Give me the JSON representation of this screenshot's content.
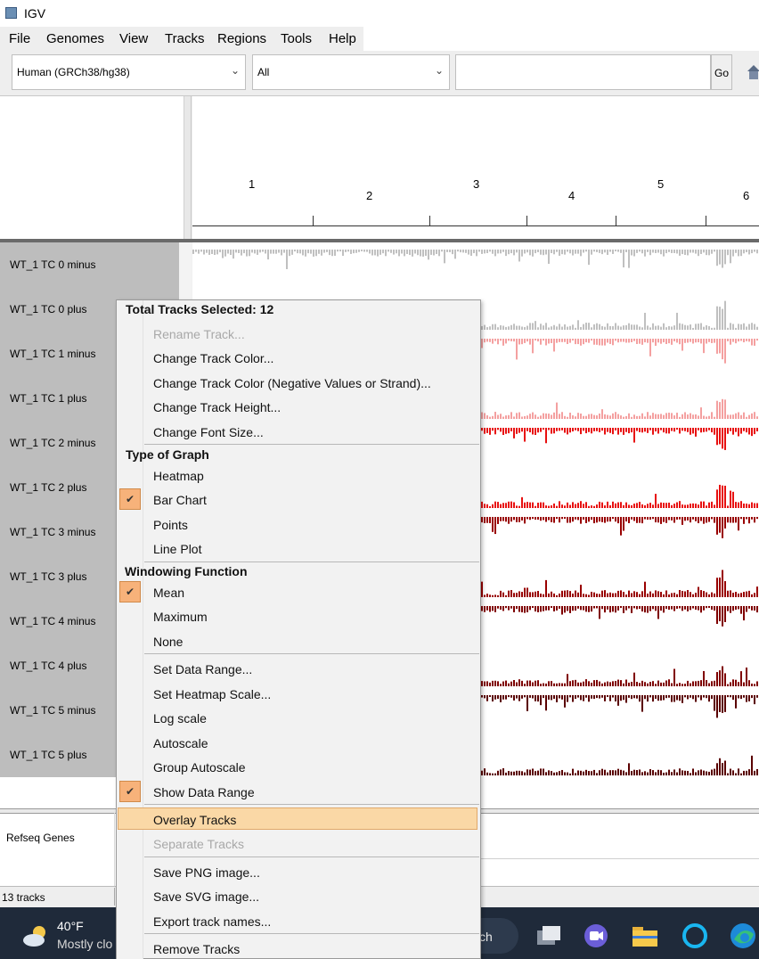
{
  "window": {
    "title": "IGV"
  },
  "menubar": [
    "File",
    "Genomes",
    "View",
    "Tracks",
    "Regions",
    "Tools",
    "Help"
  ],
  "toolbar": {
    "genome": "Human (GRCh38/hg38)",
    "chromosome": "All",
    "locus_value": "",
    "go_label": "Go"
  },
  "ruler": {
    "chromosomes": [
      "1",
      "2",
      "3",
      "4",
      "5",
      "6"
    ]
  },
  "tracks": [
    {
      "name": "WT_1 TC 0 minus",
      "color": "#c0c0c0",
      "strand": "minus"
    },
    {
      "name": "WT_1 TC 0 plus",
      "color": "#c0c0c0",
      "strand": "plus"
    },
    {
      "name": "WT_1 TC 1 minus",
      "color": "#f4a0a0",
      "strand": "minus"
    },
    {
      "name": "WT_1 TC 1 plus",
      "color": "#f4a0a0",
      "strand": "plus"
    },
    {
      "name": "WT_1 TC 2 minus",
      "color": "#e81010",
      "strand": "minus"
    },
    {
      "name": "WT_1 TC 2 plus",
      "color": "#e81010",
      "strand": "plus"
    },
    {
      "name": "WT_1 TC 3 minus",
      "color": "#990000",
      "strand": "minus"
    },
    {
      "name": "WT_1 TC 3 plus",
      "color": "#990000",
      "strand": "plus"
    },
    {
      "name": "WT_1 TC 4 minus",
      "color": "#800000",
      "strand": "minus"
    },
    {
      "name": "WT_1 TC 4 plus",
      "color": "#800000",
      "strand": "plus"
    },
    {
      "name": "WT_1 TC 5 minus",
      "color": "#5a0000",
      "strand": "minus"
    },
    {
      "name": "WT_1 TC 5 plus",
      "color": "#5a0000",
      "strand": "plus"
    }
  ],
  "feature_track": {
    "name": "Refseq Genes"
  },
  "status": {
    "text": "13 tracks"
  },
  "taskbar": {
    "temperature": "40°F",
    "weather": "Mostly clo",
    "search": "ch"
  },
  "context_menu": {
    "header": "Total Tracks Selected: 12",
    "items": [
      {
        "label": "Rename Track...",
        "enabled": false
      },
      {
        "label": "Change Track Color...",
        "enabled": true
      },
      {
        "label": "Change Track Color (Negative Values or Strand)...",
        "enabled": true
      },
      {
        "label": "Change Track Height...",
        "enabled": true
      },
      {
        "label": "Change Font Size...",
        "enabled": true
      }
    ],
    "graph_heading": "Type of Graph",
    "graph_items": [
      {
        "label": "Heatmap",
        "checked": false
      },
      {
        "label": "Bar Chart",
        "checked": true
      },
      {
        "label": "Points",
        "checked": false
      },
      {
        "label": "Line Plot",
        "checked": false
      }
    ],
    "window_heading": "Windowing Function",
    "window_items": [
      {
        "label": "Mean",
        "checked": true
      },
      {
        "label": "Maximum",
        "checked": false
      },
      {
        "label": "None",
        "checked": false
      }
    ],
    "range_items": [
      {
        "label": "Set Data Range...",
        "checked": false
      },
      {
        "label": "Set Heatmap Scale...",
        "checked": false
      },
      {
        "label": "Log scale",
        "checked": false
      },
      {
        "label": "Autoscale",
        "checked": false
      },
      {
        "label": "Group Autoscale",
        "checked": false
      },
      {
        "label": "Show Data Range",
        "checked": true
      }
    ],
    "overlay": "Overlay Tracks",
    "separate": "Separate Tracks",
    "export_items": [
      "Save PNG image...",
      "Save SVG image...",
      "Export track names..."
    ],
    "remove": "Remove Tracks"
  }
}
